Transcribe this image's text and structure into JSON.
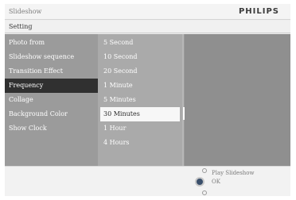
{
  "titlebar": {
    "title": "Slideshow",
    "brand": "PHILIPS"
  },
  "subbar": {
    "label": "Setting"
  },
  "menu": {
    "items": [
      "Photo from",
      "Slideshow sequence",
      "Transition Effect",
      "Frequency",
      "Collage",
      "Background Color",
      "Show Clock"
    ],
    "selected": "Frequency"
  },
  "frequency_options": {
    "items": [
      "5 Second",
      "10 Second",
      "20 Second",
      "1 Minute",
      "5 Minutes",
      "30 Minutes",
      "1 Hour",
      "4 Hours"
    ],
    "selected": "30 Minutes"
  },
  "hints": {
    "play": "Play Slideshow",
    "ok": "OK"
  },
  "colors": {
    "selected_menu": "#303030",
    "selected_option": "#f7f7f7",
    "ok_button": "#3a4f6b"
  }
}
